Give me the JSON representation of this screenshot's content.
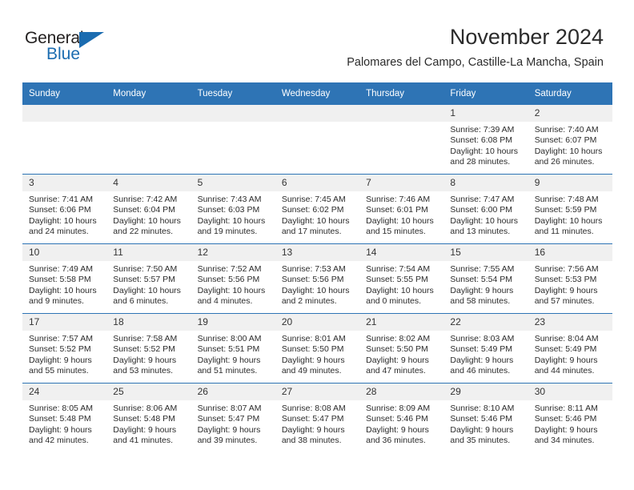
{
  "brand": {
    "name_top": "General",
    "name_bottom": "Blue",
    "triangle_color": "#1b6cb0"
  },
  "header": {
    "title": "November 2024",
    "subtitle": "Palomares del Campo, Castille-La Mancha, Spain"
  },
  "theme": {
    "accent": "#2e74b5",
    "daynum_band": "#f0f0f0",
    "text": "#2b2b2b"
  },
  "weekdays": [
    "Sunday",
    "Monday",
    "Tuesday",
    "Wednesday",
    "Thursday",
    "Friday",
    "Saturday"
  ],
  "labels": {
    "sunrise_prefix": "Sunrise:",
    "sunset_prefix": "Sunset:",
    "daylight_prefix": "Daylight:"
  },
  "weeks": [
    [
      {
        "day": "",
        "empty": true
      },
      {
        "day": "",
        "empty": true
      },
      {
        "day": "",
        "empty": true
      },
      {
        "day": "",
        "empty": true
      },
      {
        "day": "",
        "empty": true
      },
      {
        "day": "1",
        "sunrise": "Sunrise: 7:39 AM",
        "sunset": "Sunset: 6:08 PM",
        "daylight": "Daylight: 10 hours and 28 minutes."
      },
      {
        "day": "2",
        "sunrise": "Sunrise: 7:40 AM",
        "sunset": "Sunset: 6:07 PM",
        "daylight": "Daylight: 10 hours and 26 minutes."
      }
    ],
    [
      {
        "day": "3",
        "sunrise": "Sunrise: 7:41 AM",
        "sunset": "Sunset: 6:06 PM",
        "daylight": "Daylight: 10 hours and 24 minutes."
      },
      {
        "day": "4",
        "sunrise": "Sunrise: 7:42 AM",
        "sunset": "Sunset: 6:04 PM",
        "daylight": "Daylight: 10 hours and 22 minutes."
      },
      {
        "day": "5",
        "sunrise": "Sunrise: 7:43 AM",
        "sunset": "Sunset: 6:03 PM",
        "daylight": "Daylight: 10 hours and 19 minutes."
      },
      {
        "day": "6",
        "sunrise": "Sunrise: 7:45 AM",
        "sunset": "Sunset: 6:02 PM",
        "daylight": "Daylight: 10 hours and 17 minutes."
      },
      {
        "day": "7",
        "sunrise": "Sunrise: 7:46 AM",
        "sunset": "Sunset: 6:01 PM",
        "daylight": "Daylight: 10 hours and 15 minutes."
      },
      {
        "day": "8",
        "sunrise": "Sunrise: 7:47 AM",
        "sunset": "Sunset: 6:00 PM",
        "daylight": "Daylight: 10 hours and 13 minutes."
      },
      {
        "day": "9",
        "sunrise": "Sunrise: 7:48 AM",
        "sunset": "Sunset: 5:59 PM",
        "daylight": "Daylight: 10 hours and 11 minutes."
      }
    ],
    [
      {
        "day": "10",
        "sunrise": "Sunrise: 7:49 AM",
        "sunset": "Sunset: 5:58 PM",
        "daylight": "Daylight: 10 hours and 9 minutes."
      },
      {
        "day": "11",
        "sunrise": "Sunrise: 7:50 AM",
        "sunset": "Sunset: 5:57 PM",
        "daylight": "Daylight: 10 hours and 6 minutes."
      },
      {
        "day": "12",
        "sunrise": "Sunrise: 7:52 AM",
        "sunset": "Sunset: 5:56 PM",
        "daylight": "Daylight: 10 hours and 4 minutes."
      },
      {
        "day": "13",
        "sunrise": "Sunrise: 7:53 AM",
        "sunset": "Sunset: 5:56 PM",
        "daylight": "Daylight: 10 hours and 2 minutes."
      },
      {
        "day": "14",
        "sunrise": "Sunrise: 7:54 AM",
        "sunset": "Sunset: 5:55 PM",
        "daylight": "Daylight: 10 hours and 0 minutes."
      },
      {
        "day": "15",
        "sunrise": "Sunrise: 7:55 AM",
        "sunset": "Sunset: 5:54 PM",
        "daylight": "Daylight: 9 hours and 58 minutes."
      },
      {
        "day": "16",
        "sunrise": "Sunrise: 7:56 AM",
        "sunset": "Sunset: 5:53 PM",
        "daylight": "Daylight: 9 hours and 57 minutes."
      }
    ],
    [
      {
        "day": "17",
        "sunrise": "Sunrise: 7:57 AM",
        "sunset": "Sunset: 5:52 PM",
        "daylight": "Daylight: 9 hours and 55 minutes."
      },
      {
        "day": "18",
        "sunrise": "Sunrise: 7:58 AM",
        "sunset": "Sunset: 5:52 PM",
        "daylight": "Daylight: 9 hours and 53 minutes."
      },
      {
        "day": "19",
        "sunrise": "Sunrise: 8:00 AM",
        "sunset": "Sunset: 5:51 PM",
        "daylight": "Daylight: 9 hours and 51 minutes."
      },
      {
        "day": "20",
        "sunrise": "Sunrise: 8:01 AM",
        "sunset": "Sunset: 5:50 PM",
        "daylight": "Daylight: 9 hours and 49 minutes."
      },
      {
        "day": "21",
        "sunrise": "Sunrise: 8:02 AM",
        "sunset": "Sunset: 5:50 PM",
        "daylight": "Daylight: 9 hours and 47 minutes."
      },
      {
        "day": "22",
        "sunrise": "Sunrise: 8:03 AM",
        "sunset": "Sunset: 5:49 PM",
        "daylight": "Daylight: 9 hours and 46 minutes."
      },
      {
        "day": "23",
        "sunrise": "Sunrise: 8:04 AM",
        "sunset": "Sunset: 5:49 PM",
        "daylight": "Daylight: 9 hours and 44 minutes."
      }
    ],
    [
      {
        "day": "24",
        "sunrise": "Sunrise: 8:05 AM",
        "sunset": "Sunset: 5:48 PM",
        "daylight": "Daylight: 9 hours and 42 minutes."
      },
      {
        "day": "25",
        "sunrise": "Sunrise: 8:06 AM",
        "sunset": "Sunset: 5:48 PM",
        "daylight": "Daylight: 9 hours and 41 minutes."
      },
      {
        "day": "26",
        "sunrise": "Sunrise: 8:07 AM",
        "sunset": "Sunset: 5:47 PM",
        "daylight": "Daylight: 9 hours and 39 minutes."
      },
      {
        "day": "27",
        "sunrise": "Sunrise: 8:08 AM",
        "sunset": "Sunset: 5:47 PM",
        "daylight": "Daylight: 9 hours and 38 minutes."
      },
      {
        "day": "28",
        "sunrise": "Sunrise: 8:09 AM",
        "sunset": "Sunset: 5:46 PM",
        "daylight": "Daylight: 9 hours and 36 minutes."
      },
      {
        "day": "29",
        "sunrise": "Sunrise: 8:10 AM",
        "sunset": "Sunset: 5:46 PM",
        "daylight": "Daylight: 9 hours and 35 minutes."
      },
      {
        "day": "30",
        "sunrise": "Sunrise: 8:11 AM",
        "sunset": "Sunset: 5:46 PM",
        "daylight": "Daylight: 9 hours and 34 minutes."
      }
    ]
  ]
}
